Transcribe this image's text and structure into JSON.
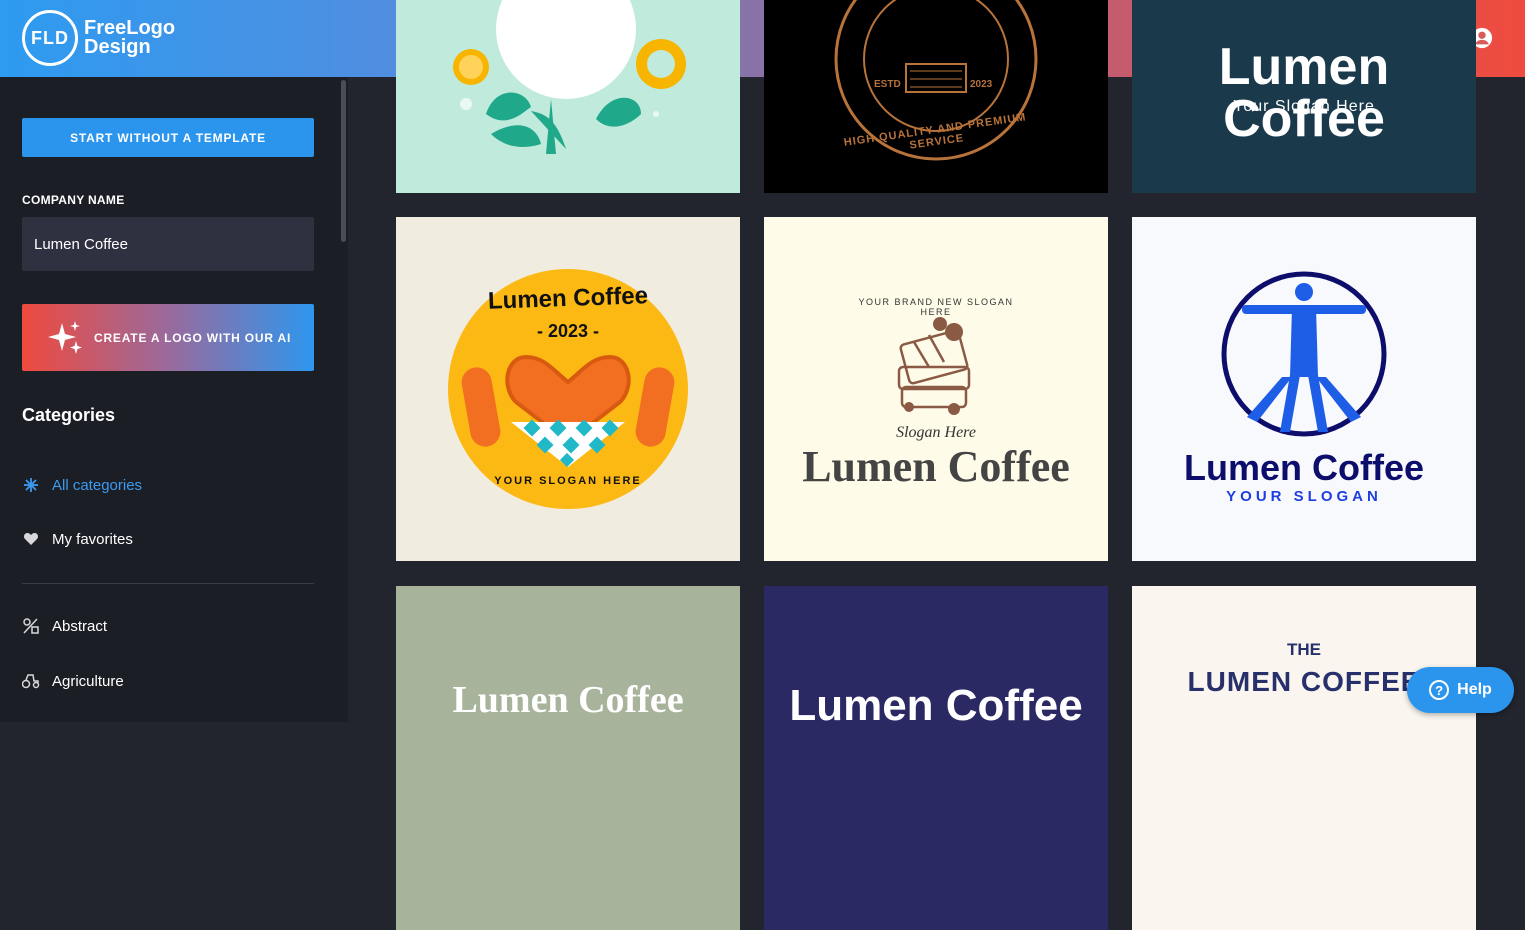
{
  "header": {
    "logo_badge": "FLD",
    "logo_line1": "FreeLogo",
    "logo_line2": "Design",
    "account_icon": "user-circle-icon"
  },
  "sidebar": {
    "start_button": "START WITHOUT A TEMPLATE",
    "company_label": "COMPANY NAME",
    "company_value": "Lumen Coffee",
    "ai_button": "CREATE A LOGO WITH OUR AI",
    "categories_title": "Categories",
    "items": [
      {
        "label": "All categories",
        "icon": "asterisk-icon",
        "active": true
      },
      {
        "label": "My favorites",
        "icon": "heart-icon",
        "active": false
      },
      {
        "label": "Abstract",
        "icon": "abstract-icon",
        "active": false
      },
      {
        "label": "Agriculture",
        "icon": "tractor-icon",
        "active": false
      }
    ]
  },
  "cards": [
    {
      "bg": "#bfeadc"
    },
    {
      "bg": "#000000",
      "texts": [
        "ESTD",
        "2023",
        "HIGH QUALITY AND PREMIUM SERVICE"
      ]
    },
    {
      "bg": "#1a3a4c",
      "name": "Lumen Coffee",
      "slogan": "Your Slogan Here"
    },
    {
      "bg": "#f0ece0",
      "name": "Lumen Coffee",
      "year": "- 2023 -",
      "slogan": "YOUR SLOGAN HERE"
    },
    {
      "bg": "#fefbe8",
      "name": "Lumen Coffee",
      "top": "YOUR BRAND NEW SLOGAN HERE",
      "slogan": "Slogan Here"
    },
    {
      "bg": "#f8f9fd",
      "name": "Lumen Coffee",
      "slogan": "YOUR SLOGAN"
    },
    {
      "bg": "#a8b39c",
      "name": "Lumen Coffee"
    },
    {
      "bg": "#2b2963",
      "name": "Lumen Coffee"
    },
    {
      "bg": "#faf6ef",
      "the": "THE",
      "name": "LUMEN COFFEE"
    }
  ],
  "help": {
    "label": "Help"
  }
}
